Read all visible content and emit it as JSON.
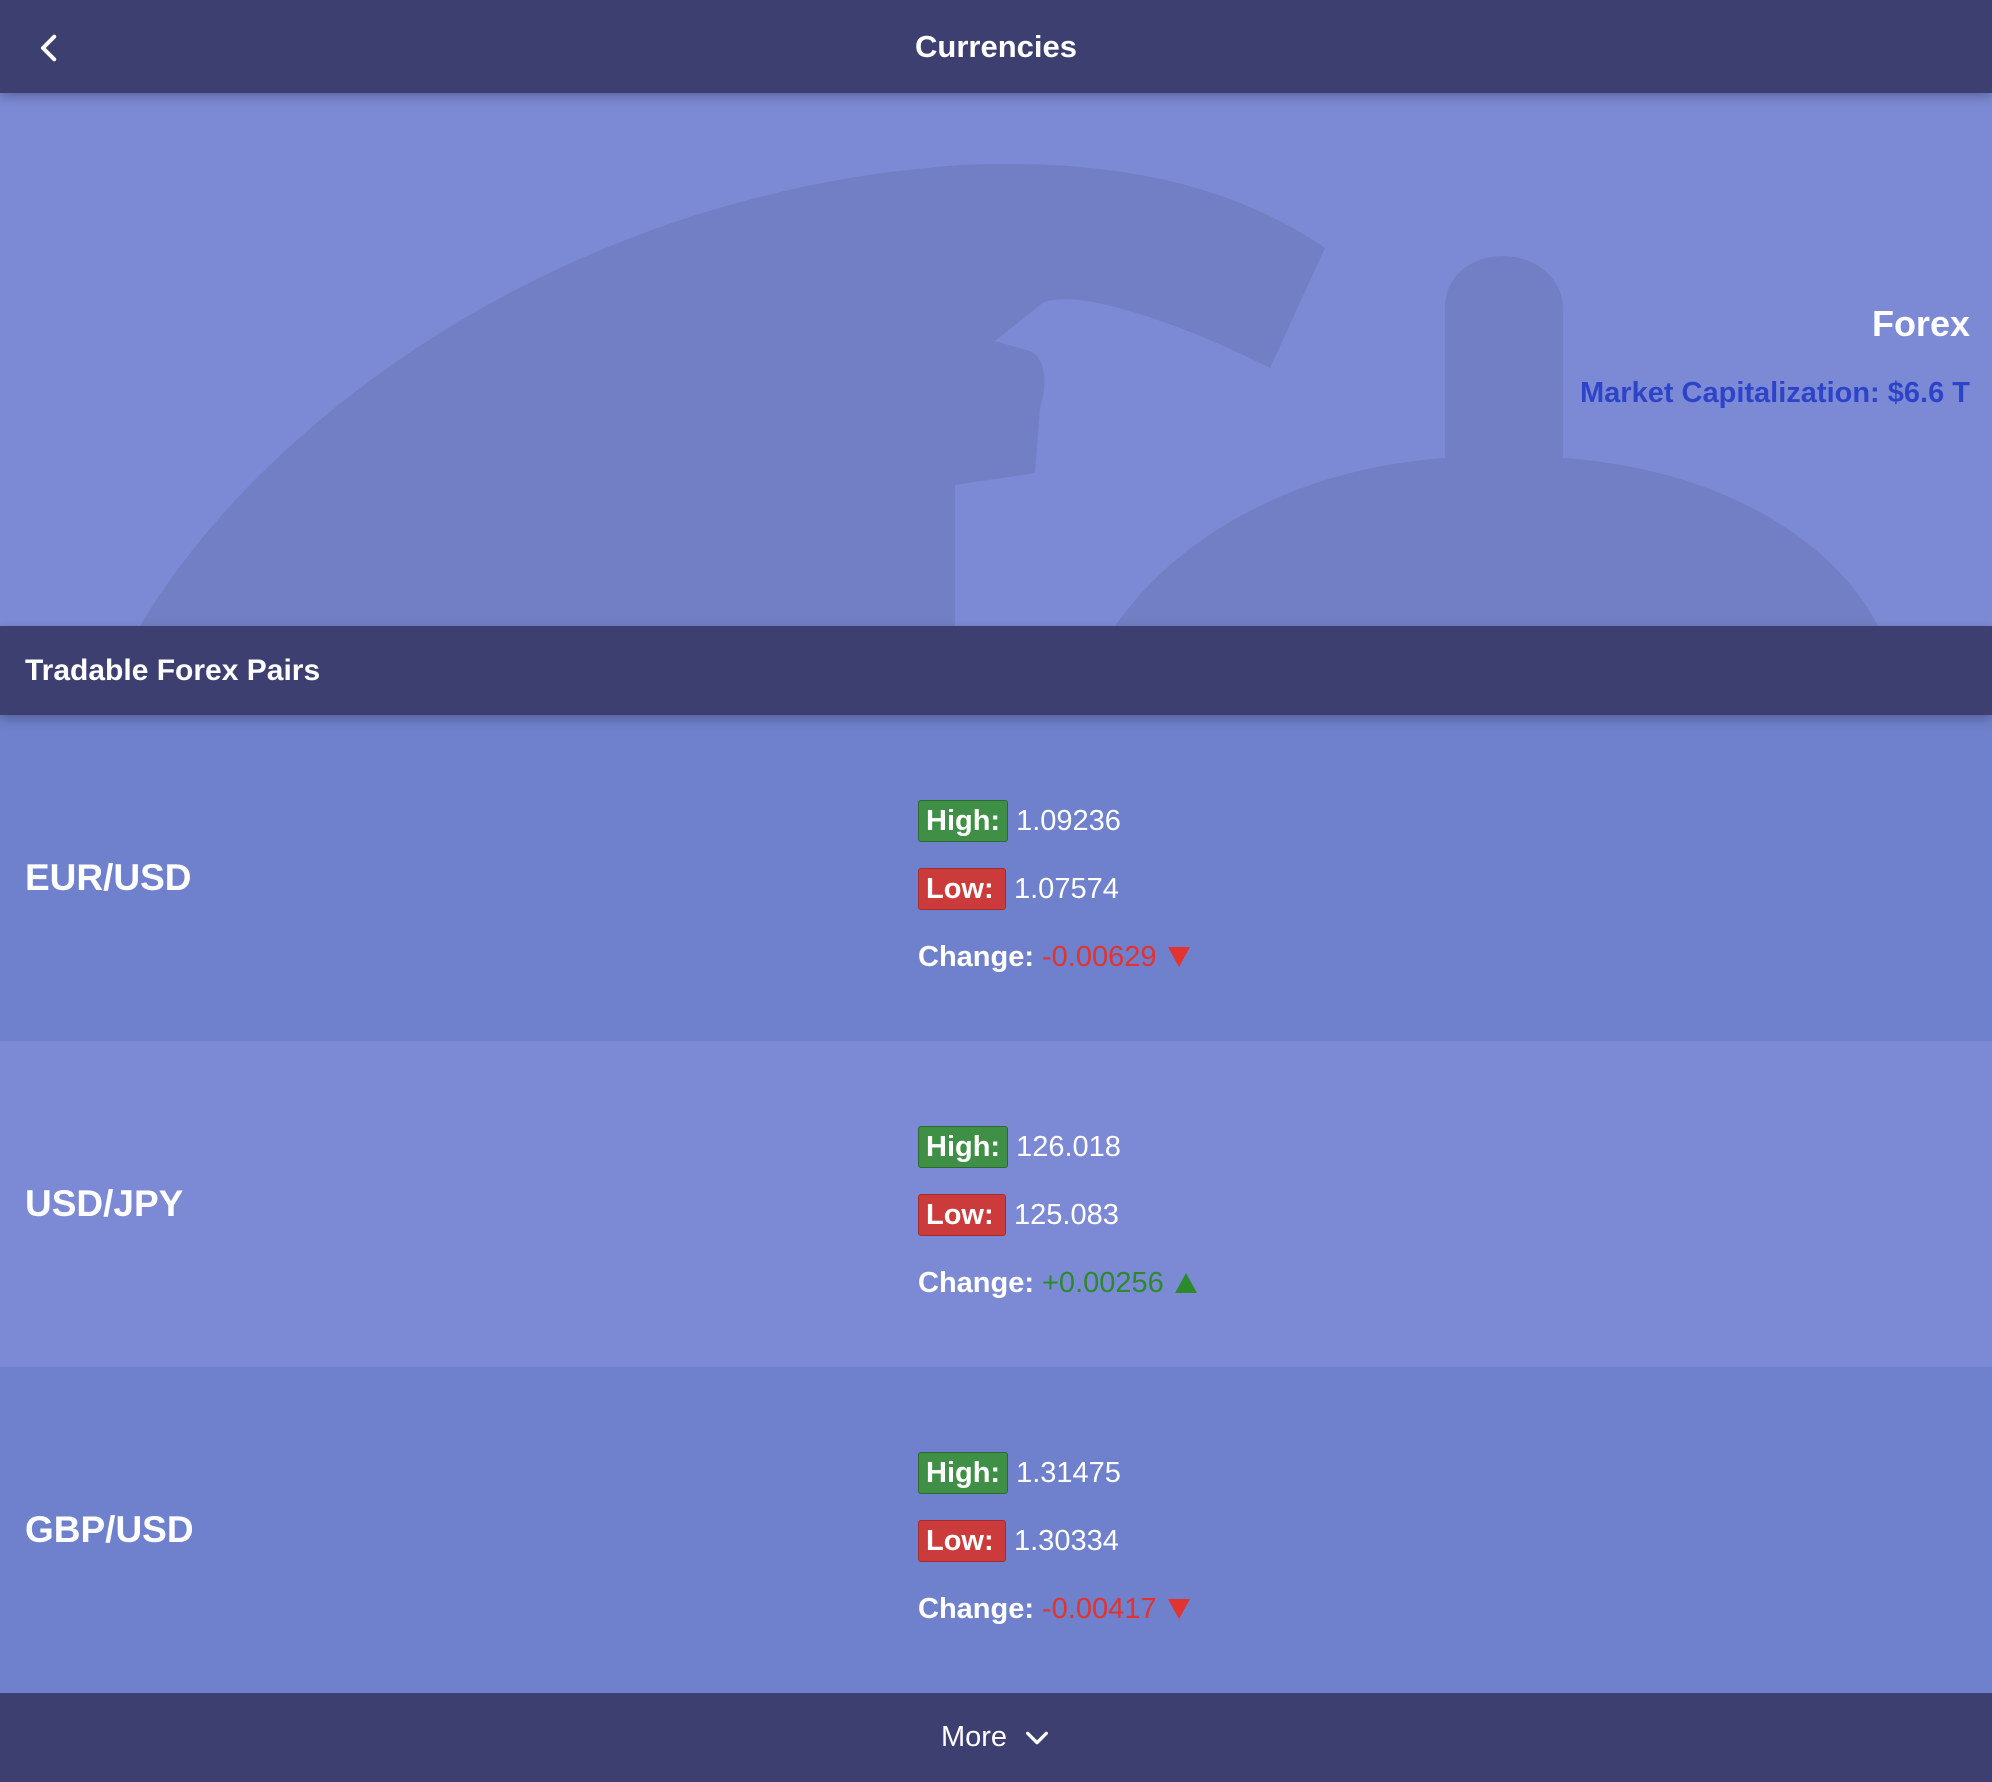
{
  "header": {
    "title": "Currencies",
    "back_icon": "chevron-left-icon"
  },
  "hero": {
    "title": "Forex",
    "market_cap": "Market Capitalization: $6.6 T"
  },
  "section": {
    "title": "Tradable Forex Pairs"
  },
  "labels": {
    "high": "High:",
    "low": "Low:",
    "change": "Change:"
  },
  "pairs": [
    {
      "name": "EUR/USD",
      "high": "1.09236",
      "low": "1.07574",
      "change": "-0.00629",
      "direction": "down"
    },
    {
      "name": "USD/JPY",
      "high": "126.018",
      "low": "125.083",
      "change": "+0.00256",
      "direction": "up"
    },
    {
      "name": "GBP/USD",
      "high": "1.31475",
      "low": "1.30334",
      "change": "-0.00417",
      "direction": "down"
    }
  ],
  "footer": {
    "more_label": "More",
    "more_icon": "chevron-down-icon"
  },
  "colors": {
    "bar": "#3c3f70",
    "hero_bg": "#7c8ad5",
    "high_badge": "#3f8f46",
    "low_badge": "#cc3b3b",
    "negative": "#e1332f",
    "positive": "#2b8a2c",
    "market_cap": "#2e44c8"
  }
}
